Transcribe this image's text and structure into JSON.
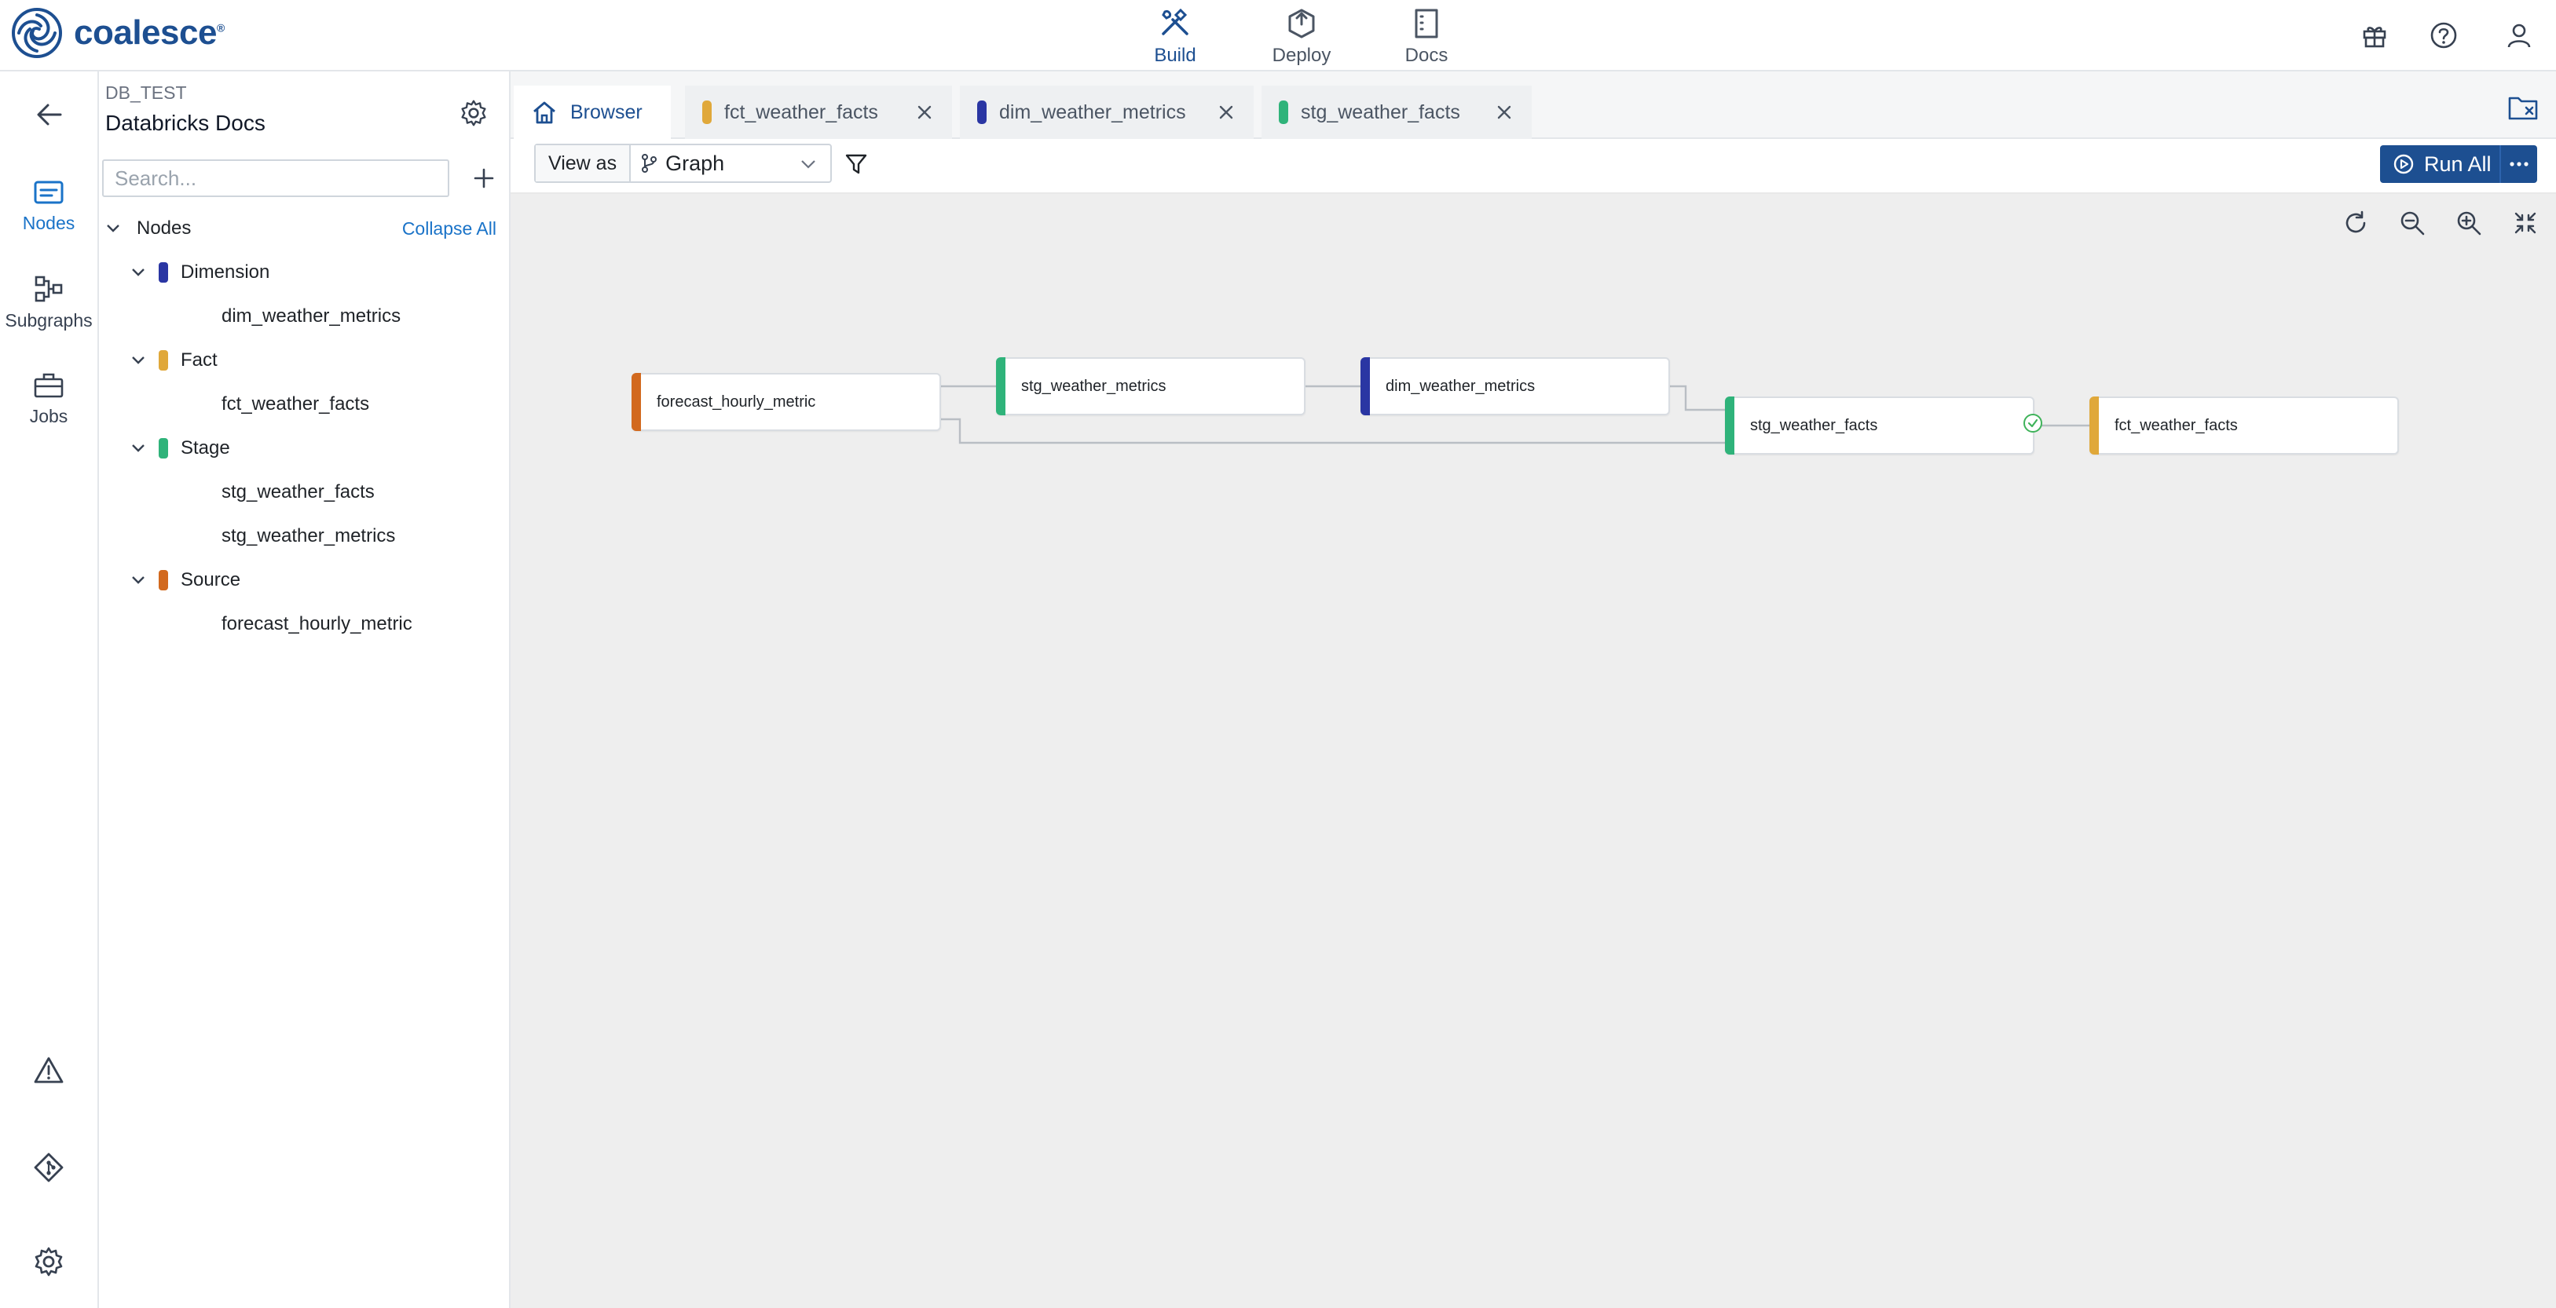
{
  "app": {
    "logo_text": "coalesce",
    "logo_mark": "®",
    "nav": [
      {
        "label": "Build",
        "icon": "build-icon",
        "active": true
      },
      {
        "label": "Deploy",
        "icon": "deploy-icon",
        "active": false
      },
      {
        "label": "Docs",
        "icon": "docs-icon",
        "active": false
      }
    ],
    "top_right_icons": [
      "gift-icon",
      "help-icon",
      "user-icon"
    ]
  },
  "rail": {
    "items": [
      {
        "label": "Nodes",
        "icon": "nodes-icon",
        "active": true
      },
      {
        "label": "Subgraphs",
        "icon": "subgraphs-icon",
        "active": false
      },
      {
        "label": "Jobs",
        "icon": "jobs-icon",
        "active": false
      }
    ],
    "bottom_icons": [
      "warning-icon",
      "git-icon",
      "settings-icon"
    ]
  },
  "sidebar": {
    "environment": "DB_TEST",
    "project": "Databricks Docs",
    "search_placeholder": "Search...",
    "root_label": "Nodes",
    "collapse_all": "Collapse All",
    "groups": [
      {
        "label": "Dimension",
        "color": "#2a36a3",
        "items": [
          "dim_weather_metrics"
        ]
      },
      {
        "label": "Fact",
        "color": "#e0a83a",
        "items": [
          "fct_weather_facts"
        ]
      },
      {
        "label": "Stage",
        "color": "#2fb37a",
        "items": [
          "stg_weather_facts",
          "stg_weather_metrics"
        ]
      },
      {
        "label": "Source",
        "color": "#d2691e",
        "items": [
          "forecast_hourly_metric"
        ]
      }
    ]
  },
  "tabs": [
    {
      "label": "Browser",
      "icon": "home-icon",
      "active": true,
      "color": ""
    },
    {
      "label": "fct_weather_facts",
      "active": false,
      "color": "#e0a83a"
    },
    {
      "label": "dim_weather_metrics",
      "active": false,
      "color": "#2a36a3"
    },
    {
      "label": "stg_weather_facts",
      "active": false,
      "color": "#2fb37a"
    }
  ],
  "toolbar": {
    "view_as_label": "View as",
    "view_as_value": "Graph",
    "run_all": "Run All"
  },
  "graph": {
    "nodes": [
      {
        "id": "forecast_hourly_metric",
        "label": "forecast_hourly_metric",
        "color": "#d2691e"
      },
      {
        "id": "stg_weather_metrics",
        "label": "stg_weather_metrics",
        "color": "#2fb37a"
      },
      {
        "id": "dim_weather_metrics",
        "label": "dim_weather_metrics",
        "color": "#2a36a3"
      },
      {
        "id": "stg_weather_facts",
        "label": "stg_weather_facts",
        "color": "#2fb37a",
        "status": "success"
      },
      {
        "id": "fct_weather_facts",
        "label": "fct_weather_facts",
        "color": "#e0a83a"
      }
    ],
    "edges": [
      [
        "forecast_hourly_metric",
        "stg_weather_metrics"
      ],
      [
        "stg_weather_metrics",
        "dim_weather_metrics"
      ],
      [
        "dim_weather_metrics",
        "stg_weather_facts"
      ],
      [
        "forecast_hourly_metric",
        "stg_weather_facts"
      ],
      [
        "stg_weather_facts",
        "fct_weather_facts"
      ]
    ]
  }
}
